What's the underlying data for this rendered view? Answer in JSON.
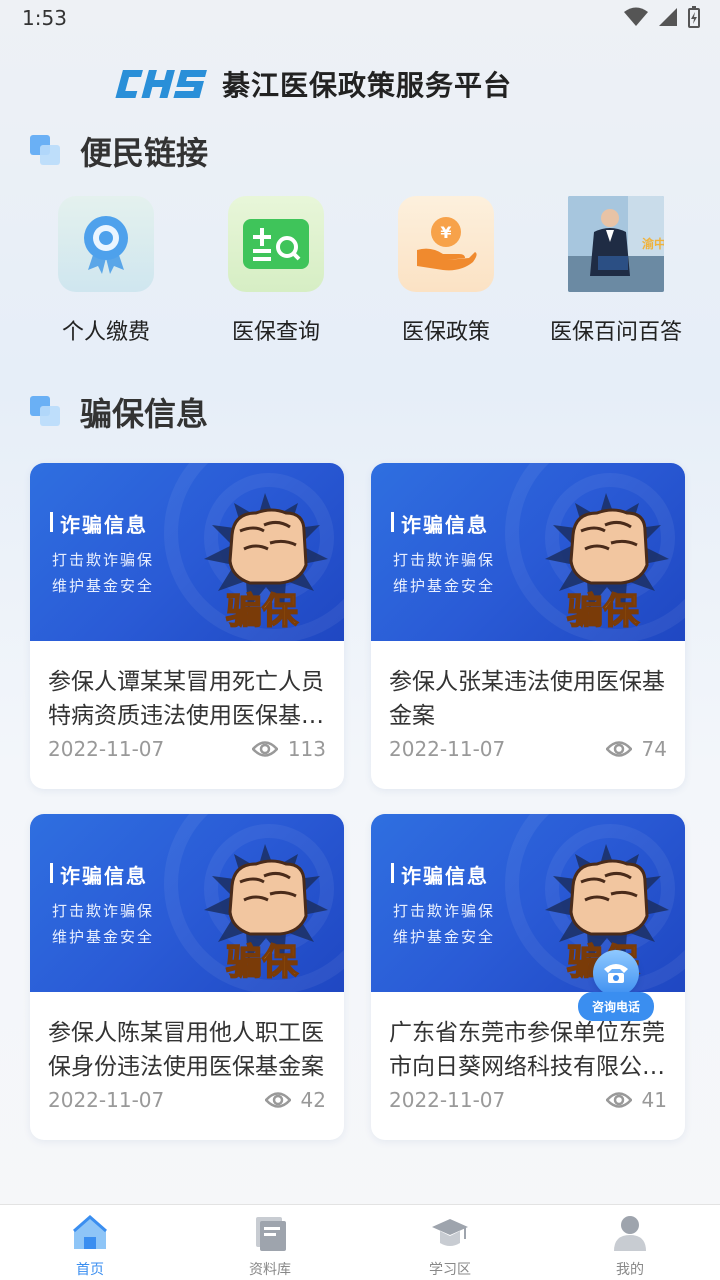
{
  "status_bar": {
    "time": "1:53"
  },
  "header": {
    "logo_text": "CHS",
    "title": "綦江医保政策服务平台"
  },
  "quick_links": {
    "section_title": "便民链接",
    "items": [
      {
        "label": "个人缴费",
        "icon": "badge-icon"
      },
      {
        "label": "医保查询",
        "icon": "search-list-icon"
      },
      {
        "label": "医保政策",
        "icon": "hand-yen-icon"
      },
      {
        "label": "医保百问百答",
        "icon": "video-thumbnail"
      }
    ]
  },
  "fraud_info": {
    "section_title": "骗保信息",
    "banner": {
      "title": "诈骗信息",
      "line1": "打击欺诈骗保",
      "line2": "维护基金安全",
      "fist_text": "骗保"
    },
    "cards": [
      {
        "title": "参保人谭某某冒用死亡人员特病资质违法使用医保基金案",
        "date": "2022-11-07",
        "views": "113"
      },
      {
        "title": "参保人张某违法使用医保基金案",
        "date": "2022-11-07",
        "views": "74"
      },
      {
        "title": "参保人陈某冒用他人职工医保身份违法使用医保基金案",
        "date": "2022-11-07",
        "views": "42"
      },
      {
        "title": "广东省东莞市参保单位东莞市向日葵网络科技有限公司案",
        "date": "2022-11-07",
        "views": "41"
      }
    ]
  },
  "consult": {
    "label": "咨询电话"
  },
  "tab_bar": {
    "tabs": [
      {
        "label": "首页",
        "active": true
      },
      {
        "label": "资料库",
        "active": false
      },
      {
        "label": "学习区",
        "active": false
      },
      {
        "label": "我的",
        "active": false
      }
    ]
  },
  "colors": {
    "accent": "#3a8ef0",
    "banner": "#2a5bd6",
    "fist_text": "#f5b52a"
  }
}
